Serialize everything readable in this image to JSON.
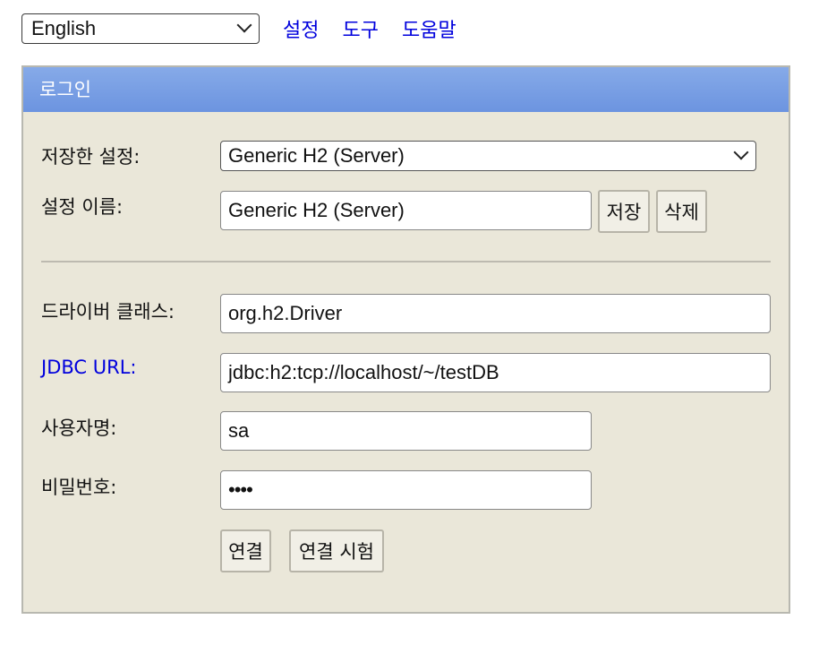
{
  "top": {
    "language": "English",
    "links": [
      "설정",
      "도구",
      "도움말"
    ]
  },
  "panel": {
    "title": "로그인",
    "saved_settings_label": "저장한 설정:",
    "saved_settings_value": "Generic H2 (Server)",
    "setting_name_label": "설정 이름:",
    "setting_name_value": "Generic H2 (Server)",
    "save_button": "저장",
    "delete_button": "삭제",
    "driver_class_label": "드라이버 클래스:",
    "driver_class_value": "org.h2.Driver",
    "jdbc_url_label_link": "JDBC URL",
    "jdbc_url_label_suffix": ":",
    "jdbc_url_value": "jdbc:h2:tcp://localhost/~/testDB",
    "username_label": "사용자명:",
    "username_value": "sa",
    "password_label": "비밀번호:",
    "password_value": "••••",
    "connect_button": "연결",
    "test_connection_button": "연결 시험"
  },
  "colors": {
    "panel_bg": "#eae7d9",
    "header_gradient": "#7aa0e5",
    "link": "#0000dd"
  }
}
